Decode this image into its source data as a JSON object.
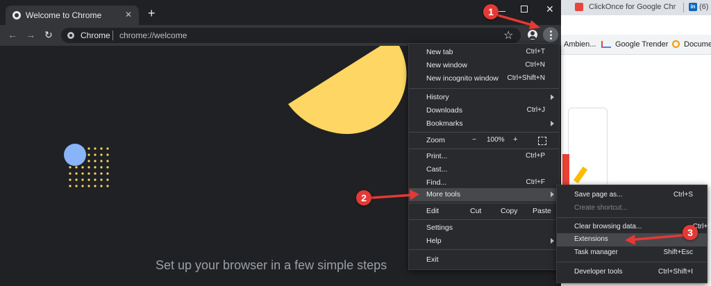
{
  "tab": {
    "title": "Welcome to Chrome"
  },
  "omnibox": {
    "site": "Chrome",
    "url": "chrome://welcome"
  },
  "background_window": {
    "tab1": "ClickOnce for Google Chr",
    "tab2": "(6)",
    "bookmarks": [
      "Ambien...",
      "Google Trender",
      "Documen"
    ]
  },
  "page": {
    "headline": "Set up your browser in a few simple steps"
  },
  "menu": {
    "new_tab": {
      "label": "New tab",
      "shortcut": "Ctrl+T"
    },
    "new_window": {
      "label": "New window",
      "shortcut": "Ctrl+N"
    },
    "new_incognito": {
      "label": "New incognito window",
      "shortcut": "Ctrl+Shift+N"
    },
    "history": {
      "label": "History"
    },
    "downloads": {
      "label": "Downloads",
      "shortcut": "Ctrl+J"
    },
    "bookmarks": {
      "label": "Bookmarks"
    },
    "zoom": {
      "label": "Zoom",
      "minus": "−",
      "value": "100%",
      "plus": "+"
    },
    "print": {
      "label": "Print...",
      "shortcut": "Ctrl+P"
    },
    "cast": {
      "label": "Cast..."
    },
    "find": {
      "label": "Find...",
      "shortcut": "Ctrl+F"
    },
    "more_tools": {
      "label": "More tools"
    },
    "edit": {
      "label": "Edit",
      "cut": "Cut",
      "copy": "Copy",
      "paste": "Paste"
    },
    "settings": {
      "label": "Settings"
    },
    "help": {
      "label": "Help"
    },
    "exit": {
      "label": "Exit"
    }
  },
  "submenu": {
    "save_page": {
      "label": "Save page as...",
      "shortcut": "Ctrl+S"
    },
    "create_shortcut": {
      "label": "Create shortcut..."
    },
    "clear_data": {
      "label": "Clear browsing data...",
      "shortcut": "Ctrl+Shift+Del"
    },
    "extensions": {
      "label": "Extensions"
    },
    "task_manager": {
      "label": "Task manager",
      "shortcut": "Shift+Esc"
    },
    "dev_tools": {
      "label": "Developer tools",
      "shortcut": "Ctrl+Shift+I"
    }
  },
  "annotations": {
    "b1": "1",
    "b2": "2",
    "b3": "3"
  },
  "colors": {
    "accent_yellow": "#fdd663",
    "accent_blue": "#8ab4f8",
    "annotation_red": "#e53935"
  }
}
